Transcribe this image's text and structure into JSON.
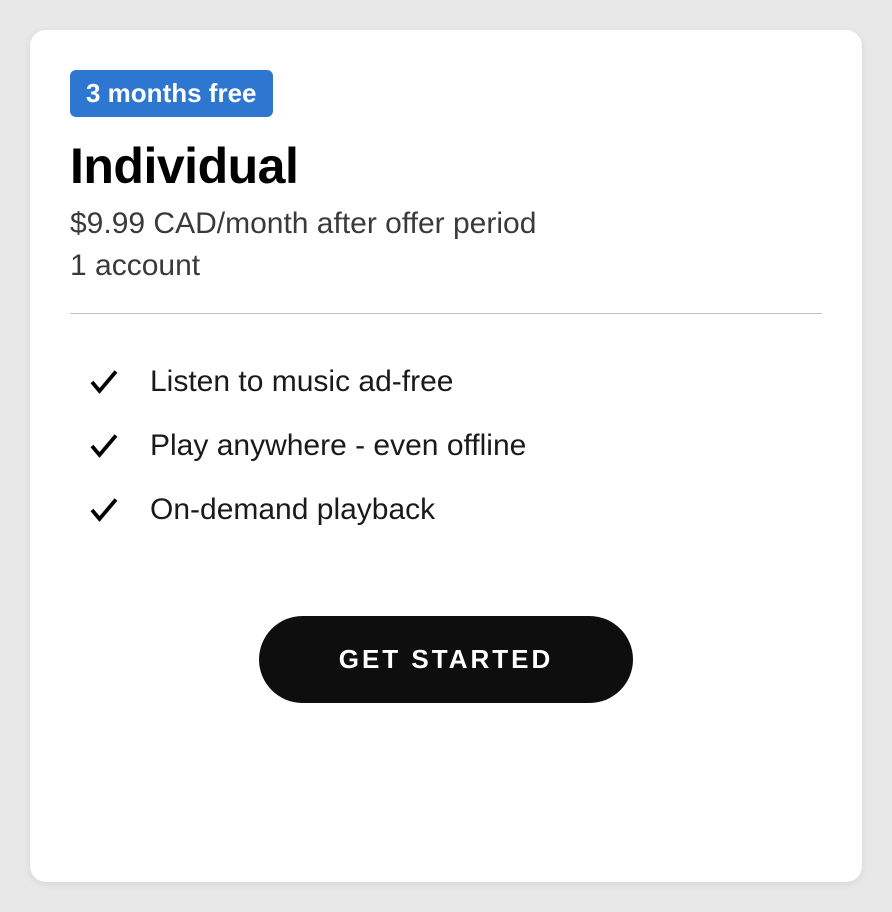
{
  "plan": {
    "badge": "3 months free",
    "title": "Individual",
    "price": "$9.99 CAD/month after offer period",
    "accounts": "1 account",
    "features": [
      "Listen to music ad-free",
      "Play anywhere - even offline",
      "On-demand playback"
    ],
    "cta": "GET STARTED"
  }
}
